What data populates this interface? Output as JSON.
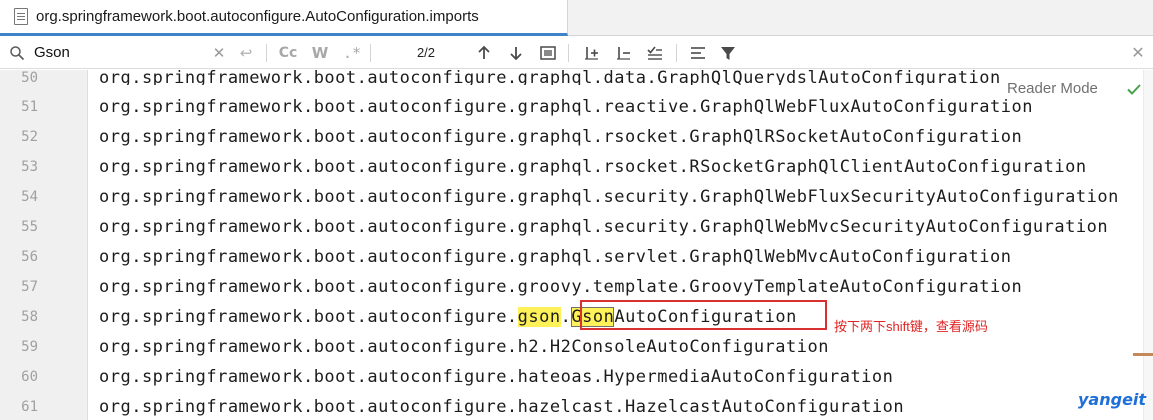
{
  "tab": {
    "title": "org.springframework.boot.autoconfigure.AutoConfiguration.imports",
    "icon": "file-text-icon"
  },
  "search": {
    "query": "Gson",
    "match_count": "2/2",
    "case_label": "Cc",
    "words_label": "W",
    "regex_label": ".*",
    "clear_glyph": "✕",
    "newline_glyph": "↩",
    "close_glyph": "✕"
  },
  "reader_mode": "Reader Mode",
  "editor": {
    "lines": [
      {
        "number": "50",
        "text": "org.springframework.boot.autoconfigure.graphql.data.GraphQlQuerydslAutoConfiguration"
      },
      {
        "number": "51",
        "text": "org.springframework.boot.autoconfigure.graphql.reactive.GraphQlWebFluxAutoConfiguration"
      },
      {
        "number": "52",
        "text": "org.springframework.boot.autoconfigure.graphql.rsocket.GraphQlRSocketAutoConfiguration"
      },
      {
        "number": "53",
        "text": "org.springframework.boot.autoconfigure.graphql.rsocket.RSocketGraphQlClientAutoConfiguration"
      },
      {
        "number": "54",
        "text": "org.springframework.boot.autoconfigure.graphql.security.GraphQlWebFluxSecurityAutoConfiguration"
      },
      {
        "number": "55",
        "text": "org.springframework.boot.autoconfigure.graphql.security.GraphQlWebMvcSecurityAutoConfiguration"
      },
      {
        "number": "56",
        "text": "org.springframework.boot.autoconfigure.graphql.servlet.GraphQlWebMvcAutoConfiguration"
      },
      {
        "number": "57",
        "text": "org.springframework.boot.autoconfigure.groovy.template.GroovyTemplateAutoConfiguration"
      },
      {
        "number": "58",
        "prefix": "org.springframework.boot.autoconfigure.",
        "match1": "gson",
        "dot": ".",
        "match2": "Gson",
        "suffix": "AutoConfiguration"
      },
      {
        "number": "59",
        "text": "org.springframework.boot.autoconfigure.h2.H2ConsoleAutoConfiguration"
      },
      {
        "number": "60",
        "text": "org.springframework.boot.autoconfigure.hateoas.HypermediaAutoConfiguration"
      },
      {
        "number": "61",
        "text": "org.springframework.boot.autoconfigure.hazelcast.HazelcastAutoConfiguration"
      }
    ]
  },
  "annotation": "按下两下shift键，查看源码",
  "watermark": "yangeit",
  "colors": {
    "match_highlight": "#fff258",
    "annotation_red": "#e02424",
    "tab_underline": "#4083c9"
  }
}
